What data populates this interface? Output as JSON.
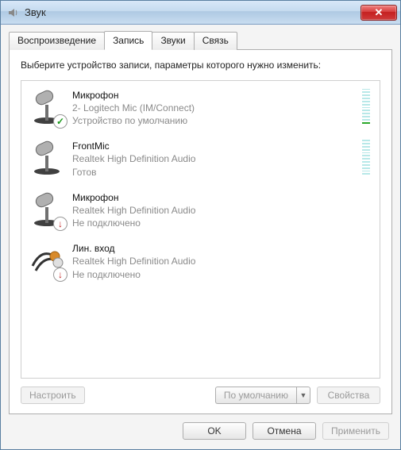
{
  "window": {
    "title": "Звук"
  },
  "tabs": {
    "playback": "Воспроизведение",
    "recording": "Запись",
    "sounds": "Звуки",
    "communications": "Связь",
    "active": "recording"
  },
  "panel": {
    "instruction": "Выберите устройство записи, параметры которого нужно изменить:"
  },
  "devices": [
    {
      "name": "Микрофон",
      "sub1": "2- Logitech Mic (IM/Connect)",
      "sub2": "Устройство по умолчанию",
      "icon": "mic",
      "badge": "ok",
      "meter": true,
      "meter_on": 1
    },
    {
      "name": "FrontMic",
      "sub1": "Realtek High Definition Audio",
      "sub2": "Готов",
      "icon": "mic",
      "badge": "",
      "meter": true,
      "meter_on": 0
    },
    {
      "name": "Микрофон",
      "sub1": "Realtek High Definition Audio",
      "sub2": "Не подключено",
      "icon": "mic",
      "badge": "down",
      "meter": false,
      "meter_on": 0
    },
    {
      "name": "Лин. вход",
      "sub1": "Realtek High Definition Audio",
      "sub2": "Не подключено",
      "icon": "linein",
      "badge": "down",
      "meter": false,
      "meter_on": 0
    }
  ],
  "buttons": {
    "configure": "Настроить",
    "set_default": "По умолчанию",
    "properties": "Свойства",
    "ok": "OK",
    "cancel": "Отмена",
    "apply": "Применить"
  }
}
